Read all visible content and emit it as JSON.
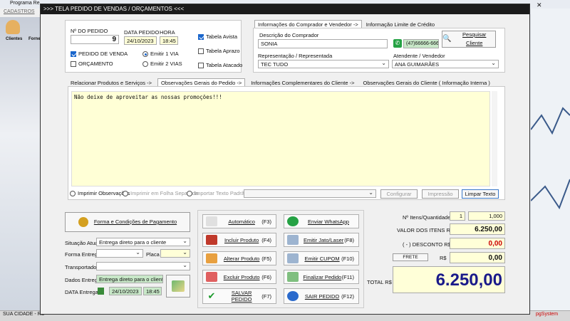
{
  "window": {
    "title": ">>>   TELA PEDIDO DE VENDAS / ORÇAMENTOS   <<<"
  },
  "background": {
    "app_title": "Programa Re",
    "menu": "CADASTROS",
    "toolbar": [
      "Clientes",
      "Forne"
    ],
    "status": "SUA CIDADE - RS",
    "status_right": "pgSystem"
  },
  "order": {
    "number_label": "Nº DO PEDIDO",
    "number": "9",
    "date_label": "DATA PEDIDO",
    "date": "24/10/2023",
    "time_label": "HORA",
    "time": "18:45",
    "pedido_venda": "PEDIDO DE VENDA",
    "orcamento": "ORÇAMENTO",
    "emitir1": "Emitir 1 VIA",
    "emitir2": "Emitir 2 VIAS",
    "tabela_avista": "Tabela Avista",
    "tabela_aprazo": "Tabela Aprazo",
    "tabela_atacado": "Tabela Atacado"
  },
  "buyer": {
    "tabs": [
      "Informações do Comprador e Vendedor ->",
      "Informação Limite de Crédito"
    ],
    "desc_label": "Descrição do Comprador",
    "desc": "SONIA",
    "phone": "(47)66666-6666",
    "search_button": "Pesquisar Cliente",
    "rep_label": "Representação / Representada",
    "rep": "TEC TUDO",
    "att_label": "Atendente / Vendedor",
    "att": "ANA GUIMARÃES"
  },
  "notes": {
    "tabs": [
      "Relacionar Produtos e Serviços ->",
      "Observações Gerais do Pedido ->",
      "Informações Complementares do Cliente ->",
      "Observações Gerais do Cliente ( Informação Interna )"
    ],
    "text": "Não deixe de aproveitar as nossas promoções!!!",
    "opt_imprimir": "Imprimir Observações",
    "opt_folha": "Imprimir em Folha Separada",
    "opt_importar": "Importar Texto Padrão",
    "btn_configurar": "Configurar",
    "btn_impressao": "Impressão",
    "btn_limpar": "Limpar Texto"
  },
  "payment": {
    "button": "Forma e Condições de Pagamento",
    "situacao_label": "Situação Atual",
    "situacao": "Entrega direto para o cliente",
    "forma_label": "Forma Entrega",
    "forma": "",
    "placa_label": "Placa",
    "placa": "",
    "transp_label": "Transportador",
    "transp": "",
    "dados_label": "Dados Entrega",
    "dados": "Entrega direto para o cliente",
    "data_label": "DATA Entrega",
    "data": "24/10/2023",
    "hora": "18:45"
  },
  "actions": [
    {
      "label": "Automático",
      "key": "(F3)"
    },
    {
      "label": "Enviar WhatsApp",
      "key": ""
    },
    {
      "label": "Incluir Produto",
      "key": "(F4)"
    },
    {
      "label": "Emitir Jato/Laser",
      "key": "(F8)"
    },
    {
      "label": "Alterar Produto",
      "key": "(F5)"
    },
    {
      "label": "Emitir CUPOM",
      "key": "(F10)"
    },
    {
      "label": "Excluir Produto",
      "key": "(F6)"
    },
    {
      "label": "Finalizar Pedido",
      "key": "(F11)"
    },
    {
      "label": "SALVAR PEDIDO",
      "key": "(F7)"
    },
    {
      "label": "SAIR  PEDIDO",
      "key": "(F12)"
    }
  ],
  "totals": {
    "itens_label": "Nº Itens/Quantidade",
    "itens": "1",
    "quantidade": "1,000",
    "valor_label": "VALOR DOS ITENS R$",
    "valor": "6.250,00",
    "desconto_label": "( - ) DESCONTO R$",
    "desconto": "0,00",
    "frete_label": "FRETE",
    "frete_rs": "R$",
    "frete": "0,00",
    "total_label": "TOTAL R$",
    "total": "6.250,00"
  },
  "colors": {
    "negative": "#cc0000",
    "title_bg": "#1b1b1b",
    "accent": "#1a66cc"
  }
}
